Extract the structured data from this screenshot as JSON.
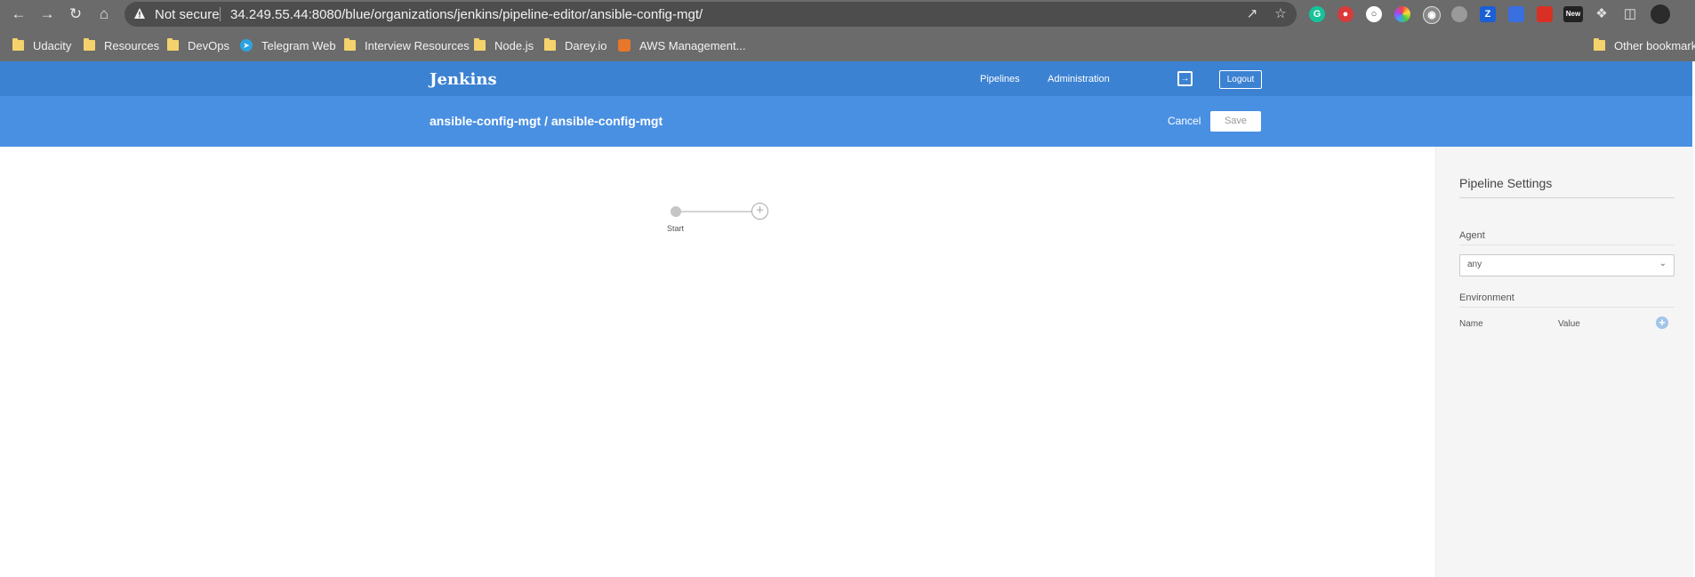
{
  "browser": {
    "security_label": "Not secure",
    "url": "34.249.55.44:8080/blue/organizations/jenkins/pipeline-editor/ansible-config-mgt/",
    "extension_badge": "New",
    "bookmarks": [
      {
        "label": "Udacity",
        "icon": "folder-icon"
      },
      {
        "label": "Resources",
        "icon": "folder-icon"
      },
      {
        "label": "DevOps",
        "icon": "folder-icon"
      },
      {
        "label": "Telegram Web",
        "icon": "telegram-icon"
      },
      {
        "label": "Interview Resources",
        "icon": "folder-icon"
      },
      {
        "label": "Node.js",
        "icon": "folder-icon"
      },
      {
        "label": "Darey.io",
        "icon": "folder-icon"
      },
      {
        "label": "AWS Management...",
        "icon": "aws-icon"
      }
    ],
    "other_bookmarks": "Other bookmarks"
  },
  "jenkins": {
    "logo": "Jenkins",
    "nav": {
      "pipelines": "Pipelines",
      "administration": "Administration"
    },
    "logout": "Logout",
    "title": "ansible-config-mgt / ansible-config-mgt",
    "cancel": "Cancel",
    "save": "Save"
  },
  "editor": {
    "start_label": "Start"
  },
  "settings": {
    "title": "Pipeline Settings",
    "agent_label": "Agent",
    "agent_value": "any",
    "environment_label": "Environment",
    "col_name": "Name",
    "col_value": "Value"
  },
  "colors": {
    "header_dark": "#3c82d2",
    "header_light": "#4a90e2",
    "chrome": "#6b6b6b"
  }
}
